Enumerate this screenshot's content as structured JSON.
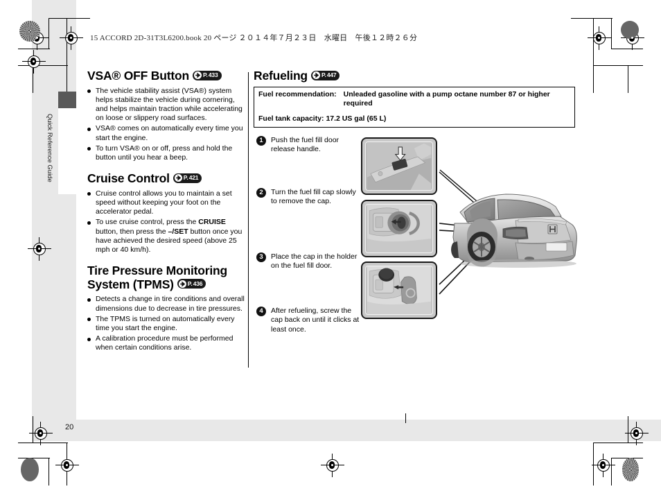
{
  "print_slug": "15 ACCORD 2D-31T3L6200.book  20 ページ  ２０１４年７月２３日　水曜日　午後１２時２６分",
  "side_tab": {
    "label": "Quick Reference Guide"
  },
  "page_number": "20",
  "left_column": {
    "sections": [
      {
        "title": "VSA® OFF Button",
        "page_ref": {
          "prefix": "P.",
          "page": "433",
          "icon": "arrow-right-icon"
        },
        "bullets": [
          "The vehicle stability assist (VSA®) system helps stabilize the vehicle during cornering, and helps maintain traction while accelerating on loose or slippery road surfaces.",
          "VSA® comes on automatically every time you start the engine.",
          "To turn VSA® on or off, press and hold the button until you hear a beep."
        ]
      },
      {
        "title": "Cruise Control",
        "page_ref": {
          "prefix": "P.",
          "page": "421",
          "icon": "arrow-right-icon"
        },
        "bullets": [
          "Cruise control allows you to maintain a set speed without keeping your foot on the accelerator pedal."
        ],
        "bullet_rich": {
          "pre": "To use cruise control, press the ",
          "b1": "CRUISE",
          "mid": " button, then press the ",
          "b2": "–/SET",
          "post": " button once you have achieved the desired speed (above 25 mph or 40 km/h)."
        }
      },
      {
        "title": "Tire Pressure Monitoring System (TPMS)",
        "page_ref": {
          "prefix": "P.",
          "page": "436",
          "icon": "arrow-right-icon"
        },
        "bullets": [
          "Detects a change in tire conditions and overall dimensions due to decrease in tire pressures.",
          "The TPMS is turned on automatically every time you start the engine.",
          "A calibration procedure must be performed when certain conditions arise."
        ]
      }
    ]
  },
  "right_column": {
    "title": "Refueling",
    "page_ref": {
      "prefix": "P.",
      "page": "447",
      "icon": "arrow-right-icon"
    },
    "fuel_box": {
      "recommendation_label": "Fuel recommendation:",
      "recommendation_value": "Unleaded gasoline with a pump octane number 87 or higher required",
      "capacity_line": "Fuel tank capacity: 17.2 US gal (65 L)"
    },
    "steps": [
      {
        "num": "1",
        "text": "Push the fuel fill door release handle."
      },
      {
        "num": "2",
        "text": "Turn the fuel fill cap slowly to remove the cap."
      },
      {
        "num": "3",
        "text": "Place the cap in the holder on the fuel fill door."
      },
      {
        "num": "4",
        "text": "After refueling, screw the cap back on until it clicks at least once."
      }
    ],
    "illustrations": [
      {
        "name": "fuel-fill-door-release-handle-photo"
      },
      {
        "name": "fuel-fill-cap-removal-photo"
      },
      {
        "name": "fuel-cap-holder-photo"
      },
      {
        "name": "accord-coupe-rear-illustration"
      }
    ]
  }
}
